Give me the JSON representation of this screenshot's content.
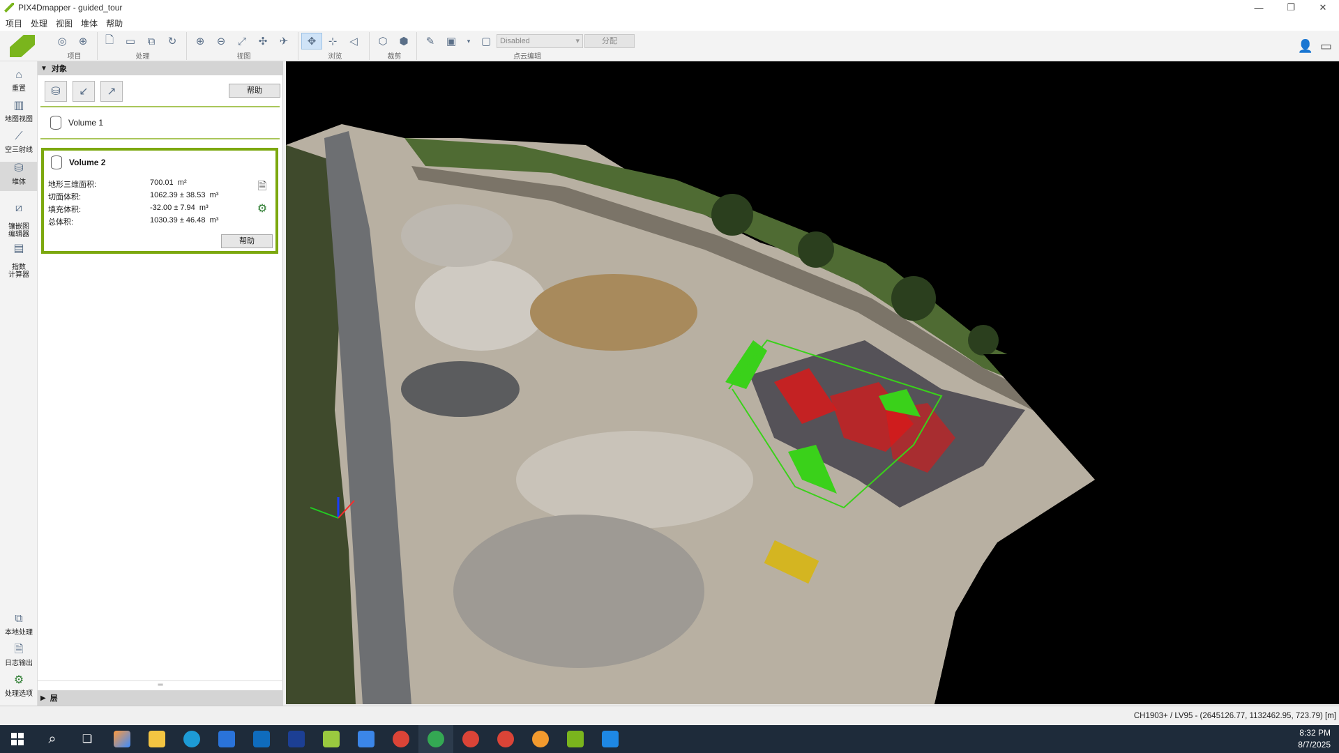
{
  "window": {
    "title": "PIX4Dmapper - guided_tour",
    "minimize": "—",
    "restore": "❐",
    "close": "✕"
  },
  "menu": [
    "项目",
    "处理",
    "视图",
    "堆体",
    "帮助"
  ],
  "toolbar": {
    "groups": [
      {
        "label": "项目",
        "icons": [
          "project-icon",
          "target-icon"
        ]
      },
      {
        "label": "处理",
        "icons": [
          "new-icon",
          "open-icon",
          "copy-icon",
          "refresh-icon"
        ]
      },
      {
        "label": "视图",
        "icons": [
          "zoom-in-icon",
          "zoom-out-icon",
          "fit-icon",
          "expand-icon",
          "plane-icon"
        ]
      },
      {
        "label": "浏览",
        "icons": [
          "navigate-icon",
          "orbit-icon",
          "perspective-icon"
        ]
      },
      {
        "label": "裁剪",
        "icons": [
          "box-icon",
          "cube-icon"
        ]
      },
      {
        "label": "点云编辑",
        "icons": [
          "pencil-icon",
          "select-icon",
          "square-icon"
        ]
      }
    ],
    "point_cloud_select": "Disabled",
    "assign_button": "分配"
  },
  "leftnav": [
    {
      "label": "重置",
      "icon": "home-icon"
    },
    {
      "label": "地图视图",
      "icon": "map-icon"
    },
    {
      "label": "空三射线",
      "icon": "rays-icon"
    },
    {
      "label": "堆体",
      "icon": "volume-icon",
      "active": true
    },
    {
      "label": "镶嵌图\n编辑器",
      "icon": "mosaic-icon"
    },
    {
      "label": "指数\n计算器",
      "icon": "index-icon"
    },
    {
      "label": "本地处理",
      "icon": "local-processing-icon"
    },
    {
      "label": "日志输出",
      "icon": "log-icon"
    },
    {
      "label": "处理选项",
      "icon": "settings-icon"
    }
  ],
  "panel": {
    "header": "对象",
    "help_label": "帮助",
    "volumes": [
      {
        "name": "Volume 1"
      }
    ],
    "selected": {
      "name": "Volume 2",
      "stats": [
        {
          "label": "地形三维面积:",
          "value": "700.01",
          "unit": "m²"
        },
        {
          "label": "切面体积:",
          "value": "1062.39  ± 38.53",
          "unit": "m³"
        },
        {
          "label": "填充体积:",
          "value": "-32.00  ± 7.94",
          "unit": "m³"
        },
        {
          "label": "总体积:",
          "value": "1030.39  ± 46.48",
          "unit": "m³"
        }
      ],
      "help_label": "帮助"
    },
    "layers": "层"
  },
  "status": {
    "coords": "CH1903+ / LV95 - (2645126.77, 1132462.95, 723.79) [m]"
  },
  "taskbar": {
    "time": "8:32 PM",
    "date": "8/7/2025"
  },
  "colors": {
    "accent_green": "#7ca80f",
    "highlight_green": "#3ad11a",
    "highlight_red": "#ff1a1a"
  }
}
